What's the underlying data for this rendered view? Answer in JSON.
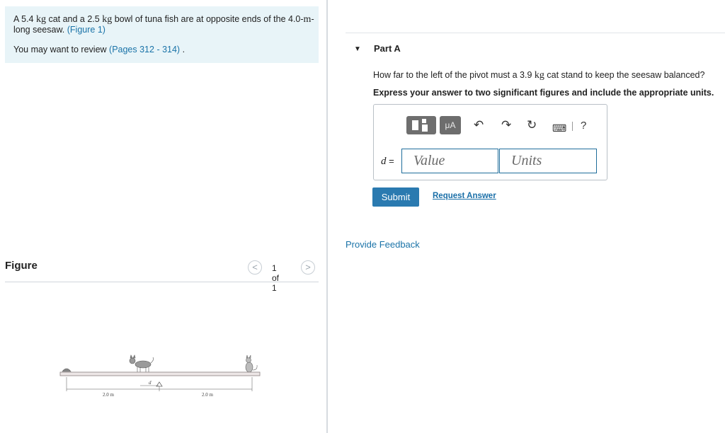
{
  "problem": {
    "text_a": "A 5.4",
    "unit_a": "kg",
    "text_b": " cat and a 2.5",
    "unit_b": "kg",
    "text_c": " bowl of tuna fish are at opposite ends of the 4.0-",
    "unit_c": "m",
    "text_d": "-long seesaw. ",
    "figure_link": "(Figure 1)",
    "review_prefix": "You may want to review ",
    "review_link": "(Pages 312 - 314)",
    "review_suffix": " ."
  },
  "figure": {
    "title": "Figure",
    "nav_prev": "<",
    "nav_next": ">",
    "counter": "1 of 1",
    "label_d": "d",
    "dim_left": "2.0 m",
    "dim_right": "2.0 m"
  },
  "part": {
    "caret": "▼",
    "title": "Part A",
    "question_a": "How far to the left of the pivot must a 3.9",
    "question_unit": "kg",
    "question_b": " cat stand to keep the seesaw balanced?",
    "instructions": "Express your answer to two significant figures and include the appropriate units."
  },
  "toolbar": {
    "units_button": "μA",
    "undo_icon": "↶",
    "redo_icon": "↷",
    "reset_icon": "↻",
    "keyboard_icon": "⌨",
    "help_icon": "?"
  },
  "answer": {
    "variable": "d",
    "equals": " =",
    "value_placeholder": "Value",
    "units_placeholder": "Units"
  },
  "actions": {
    "submit_label": "Submit",
    "request_answer_label": "Request Answer",
    "feedback_label": "Provide Feedback"
  },
  "colors": {
    "accent": "#2a7ab0",
    "link": "#1a73a8",
    "problem_bg": "#e8f4f8"
  }
}
